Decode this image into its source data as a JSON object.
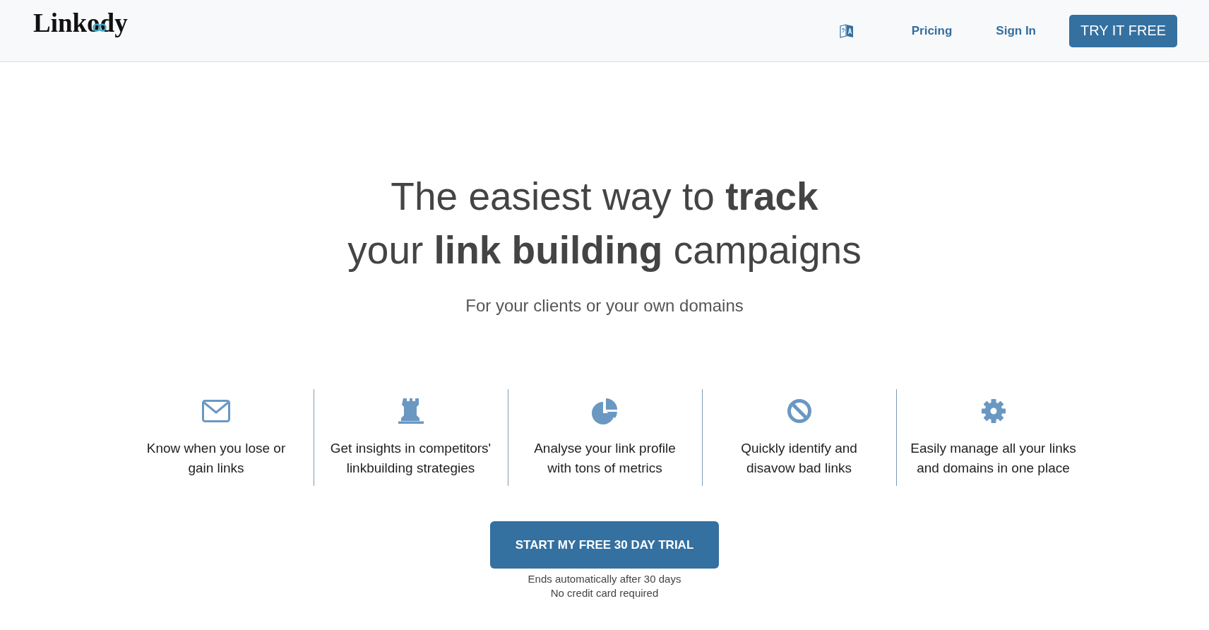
{
  "header": {
    "logo": "Linkody",
    "nav_links": [
      "Pricing",
      "Sign In"
    ],
    "cta_button": "TRY IT FREE"
  },
  "hero": {
    "headline": [
      "The easiest way to **track**",
      "your **link building** campaigns"
    ],
    "subtitle": "For your clients or your own domains"
  },
  "features": [
    {
      "kind": "mail",
      "lines": [
        "Know when you lose or",
        "gain links"
      ]
    },
    {
      "kind": "tower",
      "lines": [
        "Get insights in competitors'",
        "linkbuilding strategies"
      ]
    },
    {
      "kind": "chart",
      "lines": [
        "Analyse your link profile",
        "with tons of metrics"
      ]
    },
    {
      "kind": "block",
      "lines": [
        "Quickly identify and",
        "disavow bad links"
      ]
    },
    {
      "kind": "settings",
      "lines": [
        "Easily manage all your links",
        "and domains in one place"
      ]
    }
  ],
  "cta": {
    "button": "START MY FREE 30 DAY TRIAL",
    "notes": [
      "Ends automatically after 30 days",
      "No credit card required"
    ]
  }
}
